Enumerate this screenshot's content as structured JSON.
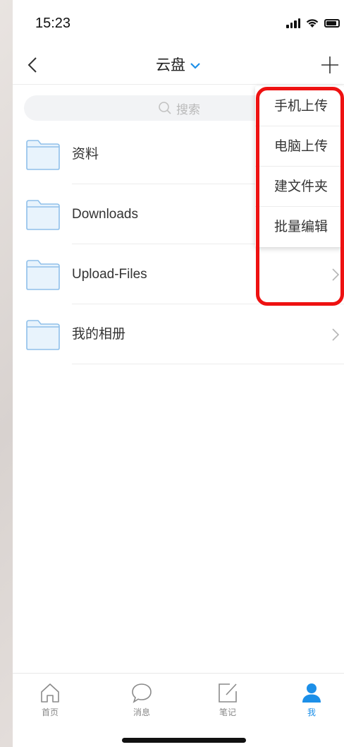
{
  "status_bar": {
    "time": "15:23"
  },
  "nav": {
    "title": "云盘"
  },
  "search": {
    "placeholder": "搜索"
  },
  "folders": [
    {
      "name": "资料"
    },
    {
      "name": "Downloads"
    },
    {
      "name": "Upload-Files"
    },
    {
      "name": "我的相册"
    }
  ],
  "menu": {
    "items": [
      {
        "label": "手机上传"
      },
      {
        "label": "电脑上传"
      },
      {
        "label": "建文件夹"
      },
      {
        "label": "批量编辑"
      }
    ]
  },
  "tabs": [
    {
      "label": "首页",
      "icon": "home-icon"
    },
    {
      "label": "消息",
      "icon": "message-icon"
    },
    {
      "label": "笔记",
      "icon": "note-icon"
    },
    {
      "label": "我",
      "icon": "user-icon",
      "active": true
    }
  ],
  "colors": {
    "accent": "#1c8fe8",
    "highlight": "#ee1111",
    "folder": "#e8f3fc"
  }
}
